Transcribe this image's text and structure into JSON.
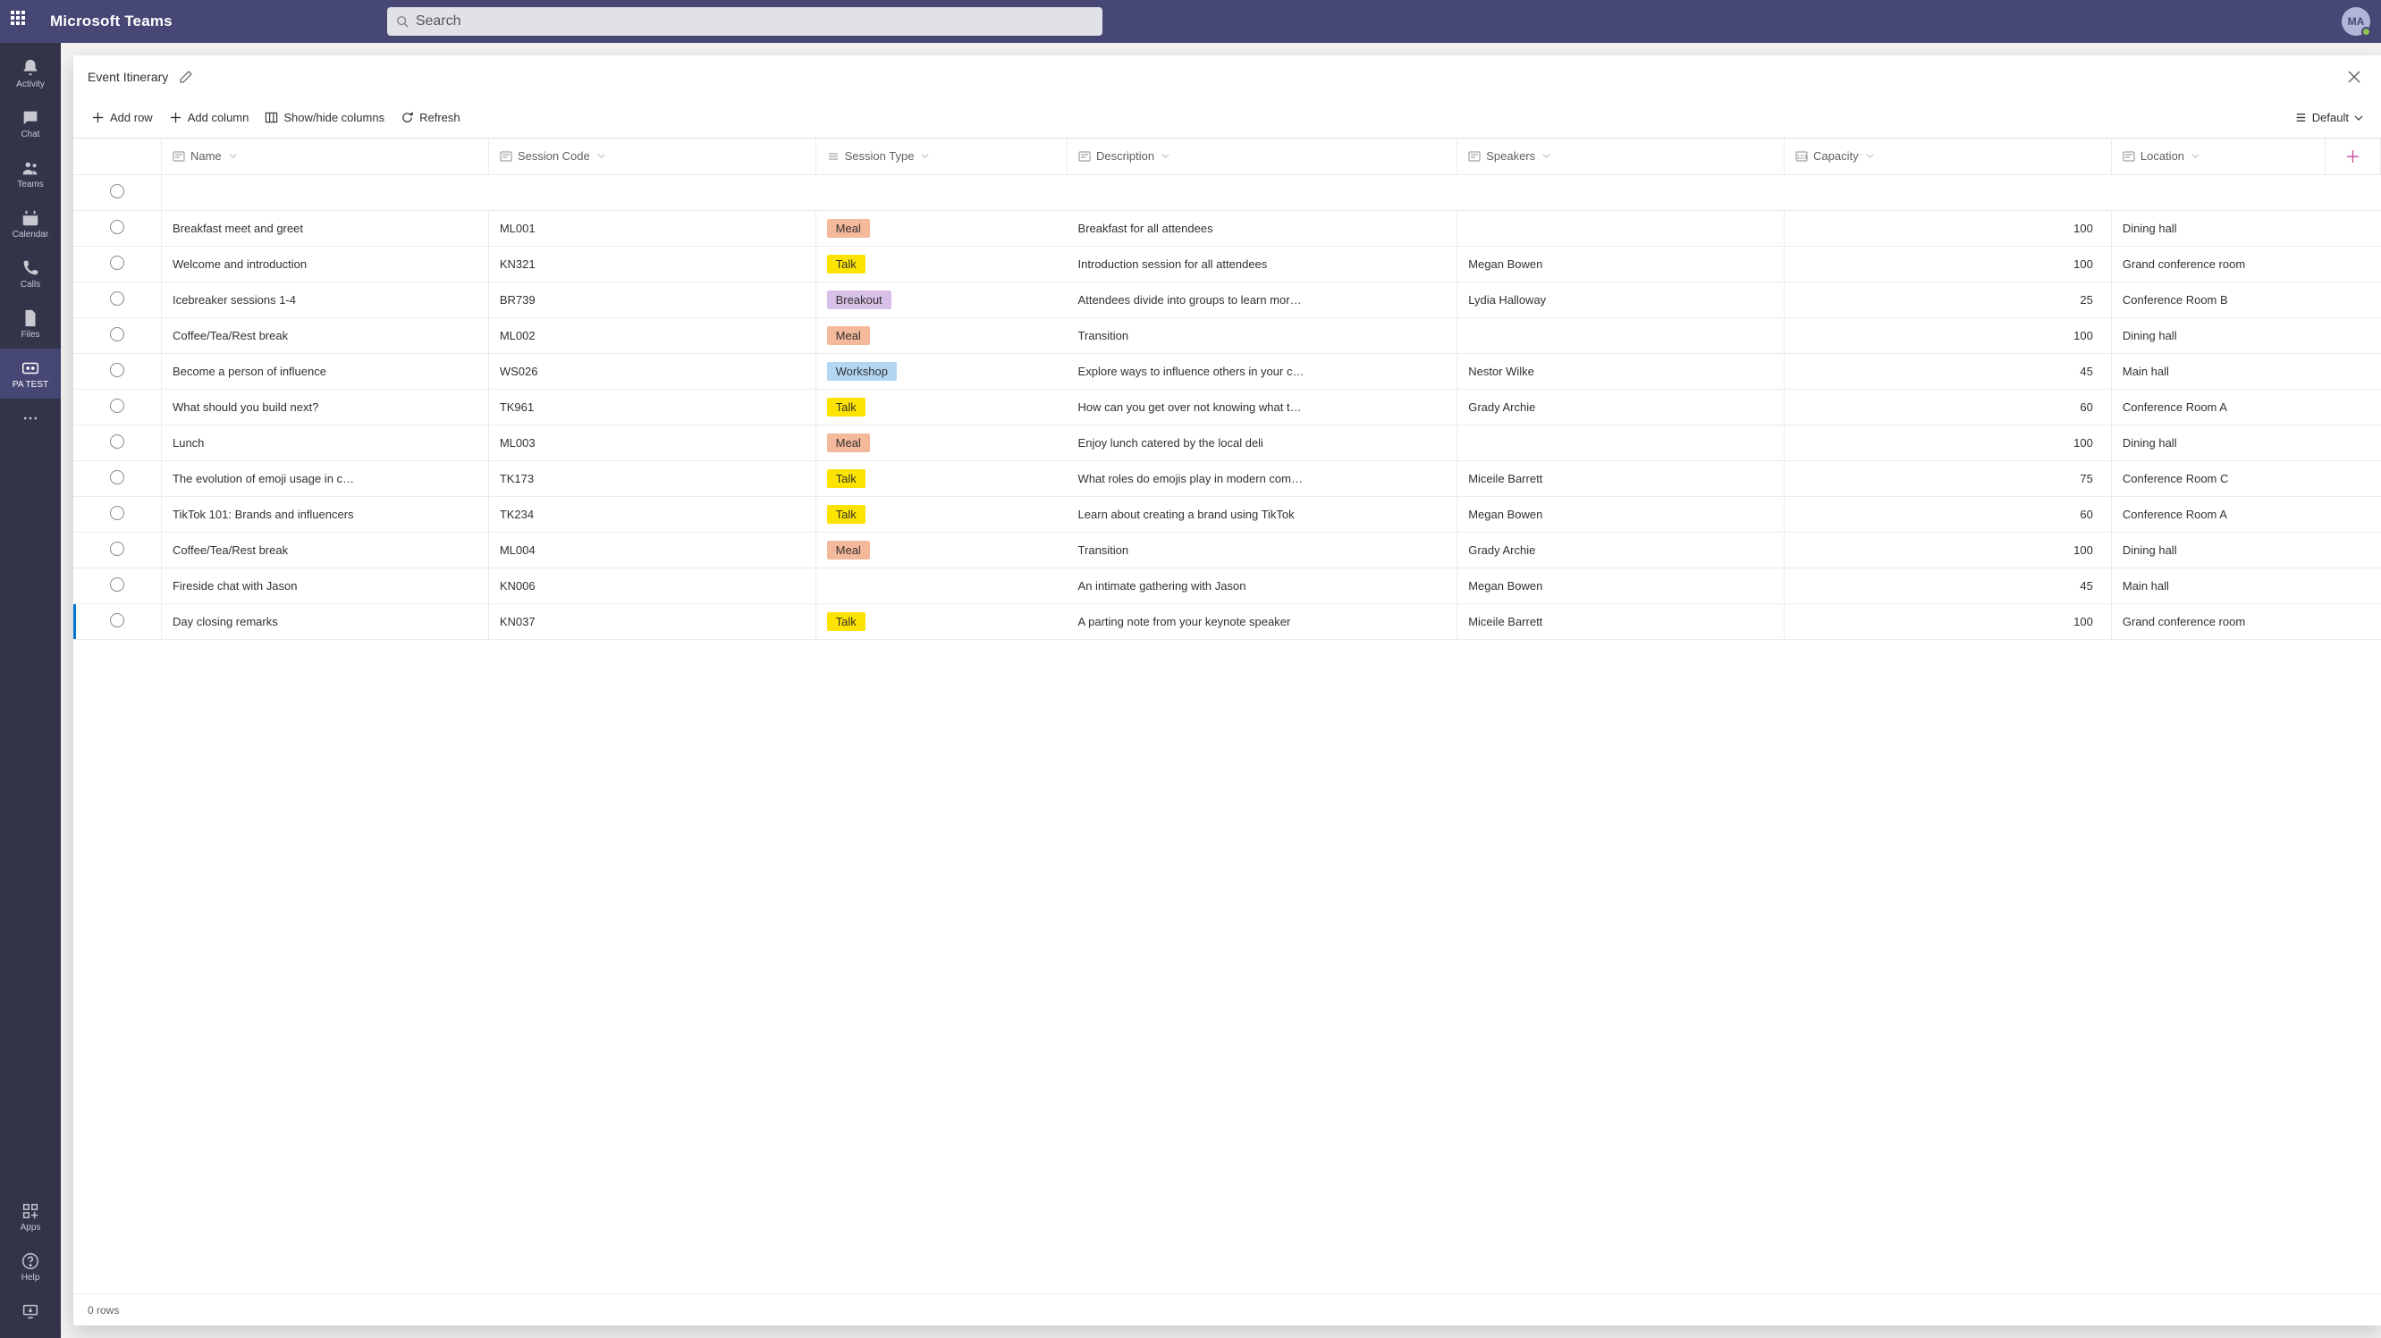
{
  "app": {
    "brand": "Microsoft Teams"
  },
  "search": {
    "placeholder": "Search"
  },
  "avatar": {
    "initials": "MA"
  },
  "rail": {
    "items": [
      {
        "id": "activity",
        "label": "Activity"
      },
      {
        "id": "chat",
        "label": "Chat"
      },
      {
        "id": "teams",
        "label": "Teams"
      },
      {
        "id": "calendar",
        "label": "Calendar"
      },
      {
        "id": "calls",
        "label": "Calls"
      },
      {
        "id": "files",
        "label": "Files"
      },
      {
        "id": "patest",
        "label": "PA TEST",
        "active": true
      }
    ],
    "apps_label": "Apps",
    "help_label": "Help"
  },
  "panel": {
    "title": "Event Itinerary",
    "toolbar": {
      "add_row": "Add row",
      "add_column": "Add column",
      "show_hide": "Show/hide columns",
      "refresh": "Refresh",
      "view_label": "Default"
    },
    "columns": {
      "name": "Name",
      "session_code": "Session Code",
      "session_type": "Session Type",
      "description": "Description",
      "speakers": "Speakers",
      "capacity": "Capacity",
      "location": "Location"
    },
    "rows": [
      {
        "name": "Breakfast meet and greet",
        "code": "ML001",
        "type": "Meal",
        "desc": "Breakfast for all attendees",
        "speakers": "",
        "capacity": 100,
        "location": "Dining hall"
      },
      {
        "name": "Welcome and introduction",
        "code": "KN321",
        "type": "Talk",
        "desc": "Introduction session for all attendees",
        "speakers": "Megan Bowen",
        "capacity": 100,
        "location": "Grand conference room"
      },
      {
        "name": "Icebreaker sessions 1-4",
        "code": "BR739",
        "type": "Breakout",
        "desc": "Attendees divide into groups to learn mor…",
        "speakers": "Lydia Halloway",
        "capacity": 25,
        "location": "Conference Room B"
      },
      {
        "name": "Coffee/Tea/Rest break",
        "code": "ML002",
        "type": "Meal",
        "desc": "Transition",
        "speakers": "",
        "capacity": 100,
        "location": "Dining hall"
      },
      {
        "name": "Become a person of influence",
        "code": "WS026",
        "type": "Workshop",
        "desc": "Explore ways to influence others in your c…",
        "speakers": "Nestor Wilke",
        "capacity": 45,
        "location": "Main hall"
      },
      {
        "name": "What should you build next?",
        "code": "TK961",
        "type": "Talk",
        "desc": "How can you get over not knowing what t…",
        "speakers": "Grady Archie",
        "capacity": 60,
        "location": "Conference Room A"
      },
      {
        "name": "Lunch",
        "code": "ML003",
        "type": "Meal",
        "desc": "Enjoy lunch catered by the local deli",
        "speakers": "",
        "capacity": 100,
        "location": "Dining hall"
      },
      {
        "name": "The evolution of emoji usage in c…",
        "code": "TK173",
        "type": "Talk",
        "desc": "What roles do emojis play in modern com…",
        "speakers": "Miceile Barrett",
        "capacity": 75,
        "location": "Conference Room C"
      },
      {
        "name": "TikTok 101: Brands and influencers",
        "code": "TK234",
        "type": "Talk",
        "desc": "Learn about creating a brand using TikTok",
        "speakers": "Megan Bowen",
        "capacity": 60,
        "location": "Conference Room A"
      },
      {
        "name": "Coffee/Tea/Rest break",
        "code": "ML004",
        "type": "Meal",
        "desc": "Transition",
        "speakers": "Grady Archie",
        "capacity": 100,
        "location": "Dining hall"
      },
      {
        "name": "Fireside chat with Jason",
        "code": "KN006",
        "type": "",
        "desc": "An intimate gathering with Jason",
        "speakers": "Megan Bowen",
        "capacity": 45,
        "location": "Main hall"
      },
      {
        "name": "Day closing remarks",
        "code": "KN037",
        "type": "Talk",
        "desc": "A parting note from your keynote speaker",
        "speakers": "Miceile Barrett",
        "capacity": 100,
        "location": "Grand conference room"
      }
    ],
    "footer": "0 rows"
  }
}
